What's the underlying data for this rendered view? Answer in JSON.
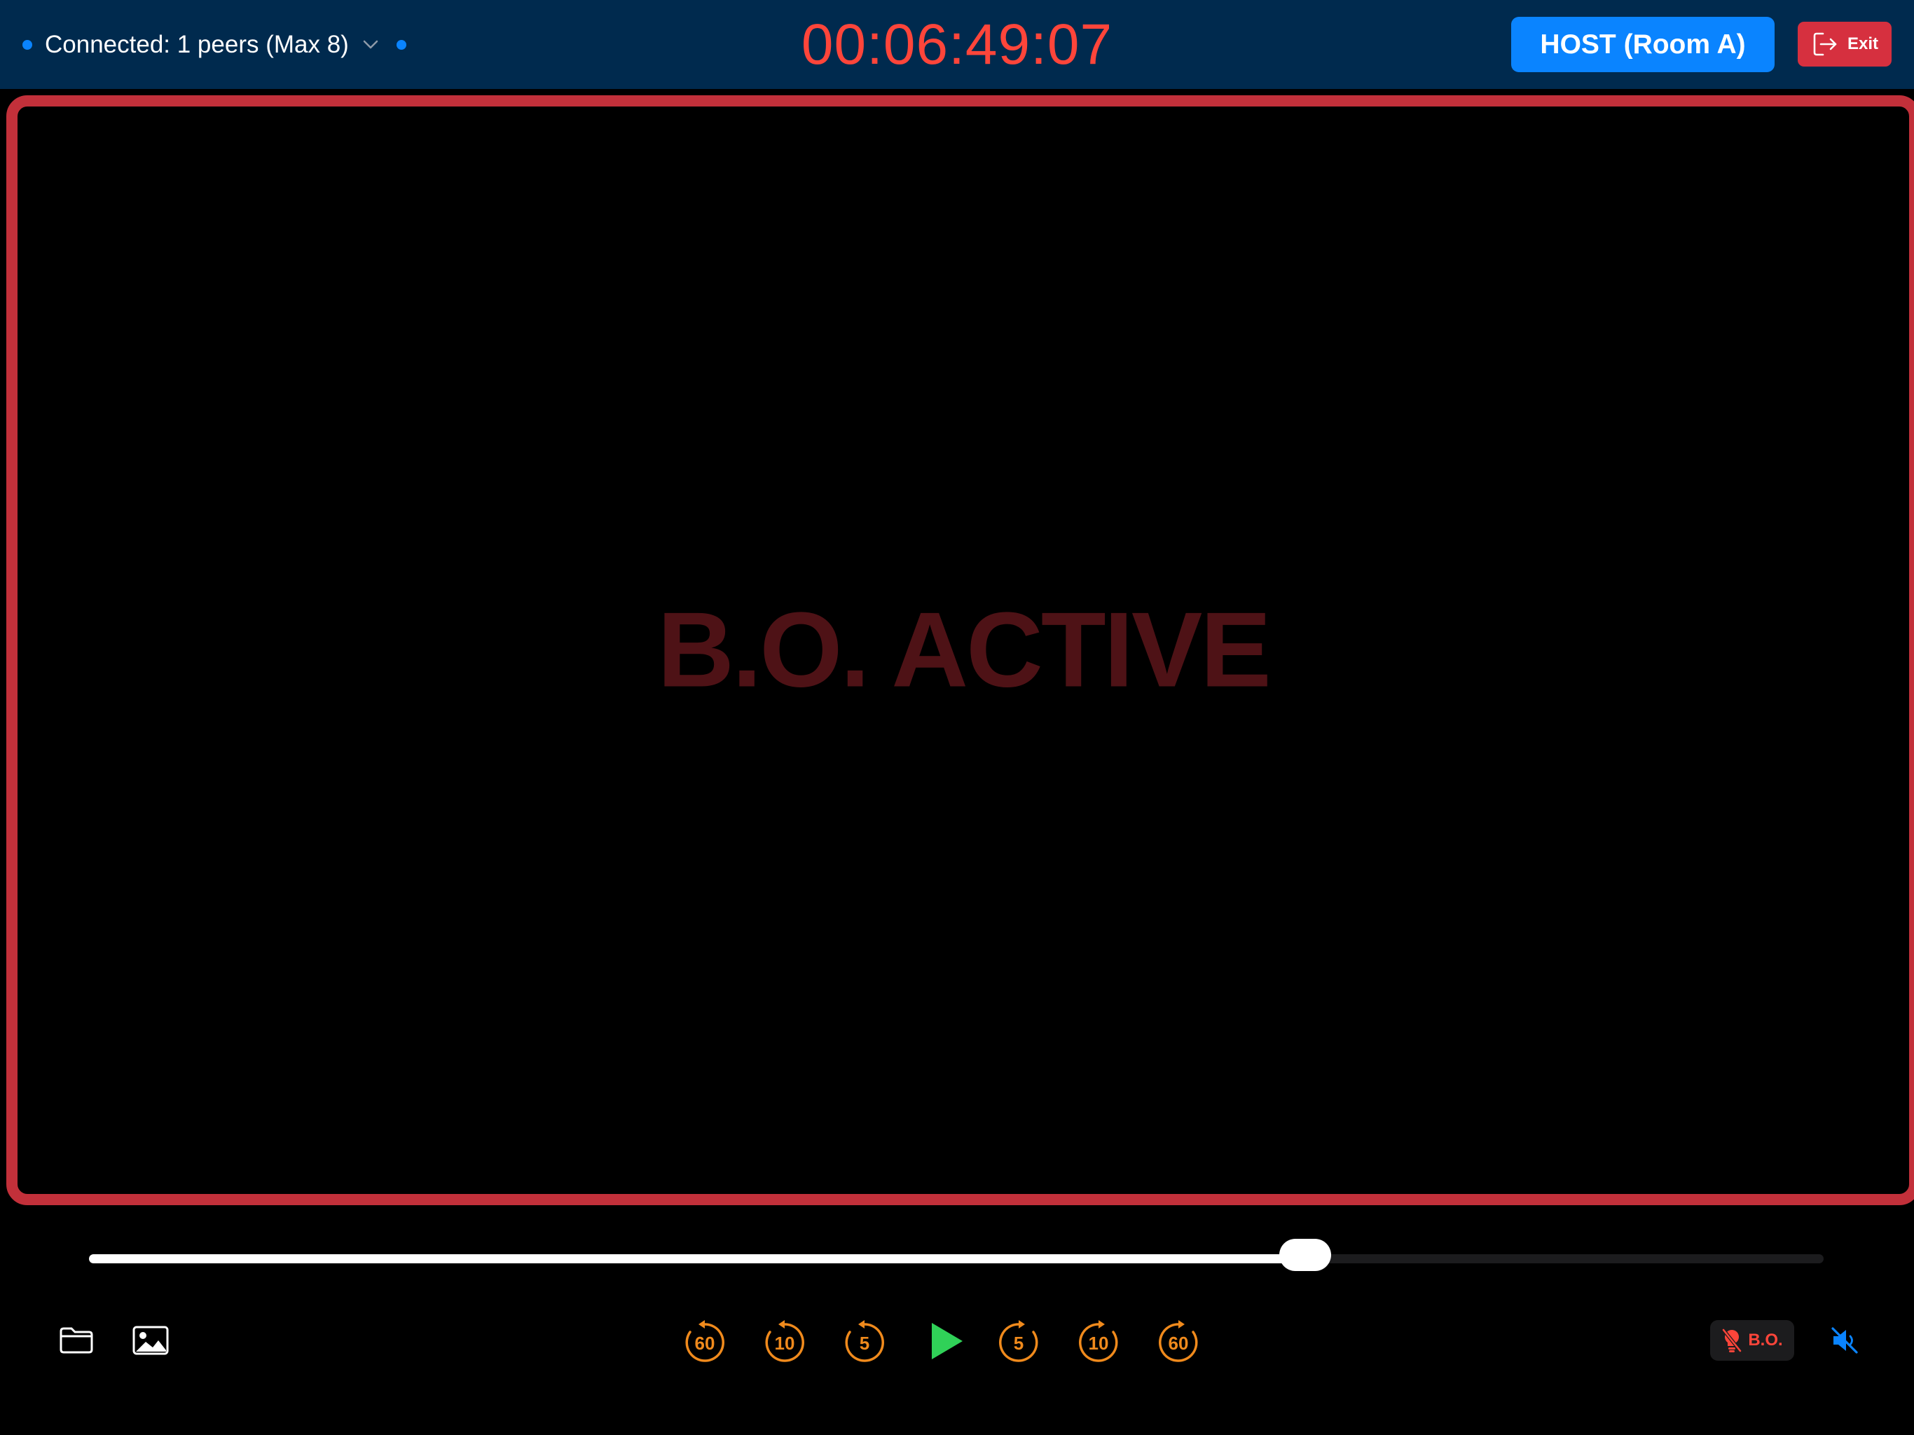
{
  "topbar": {
    "connection_status": "Connected: 1 peers (Max 8)",
    "timecode": "00:06:49:07",
    "host_label": "HOST (Room A)",
    "exit_label": "Exit"
  },
  "video": {
    "overlay_text": "B.O. ACTIVE"
  },
  "scrubber": {
    "progress": 0.701
  },
  "controls": {
    "skip_back": [
      "60",
      "10",
      "5"
    ],
    "skip_forward": [
      "5",
      "10",
      "60"
    ],
    "blackout_label": "B.O."
  },
  "colors": {
    "topbar_bg": "#002a4e",
    "accent_blue": "#0a84ff",
    "timecode_red": "#ff453a",
    "exit_red": "#d6303f",
    "frame_red": "#c2303a",
    "skip_orange": "#f08a1c",
    "play_green": "#30d158"
  },
  "icons": {
    "left": [
      "folder-icon",
      "image-icon"
    ],
    "transport": [
      "rewind-60-icon",
      "rewind-10-icon",
      "rewind-5-icon",
      "play-icon",
      "forward-5-icon",
      "forward-10-icon",
      "forward-60-icon"
    ],
    "right": [
      "lightbulb-slash-icon",
      "speaker-muted-icon"
    ]
  }
}
